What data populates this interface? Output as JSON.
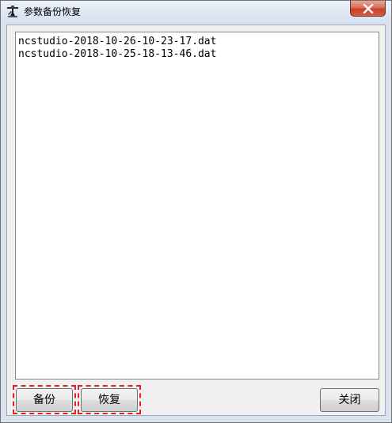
{
  "window": {
    "title": "参数备份恢复"
  },
  "files": [
    "ncstudio-2018-10-26-10-23-17.dat",
    "ncstudio-2018-10-25-18-13-46.dat"
  ],
  "buttons": {
    "backup": "备份",
    "restore": "恢复",
    "close": "关闭"
  },
  "icons": {
    "app": "machine-tool-icon",
    "close": "close-x-icon"
  },
  "colors": {
    "highlight": "#e0202a",
    "close_button": "#c6402a"
  }
}
